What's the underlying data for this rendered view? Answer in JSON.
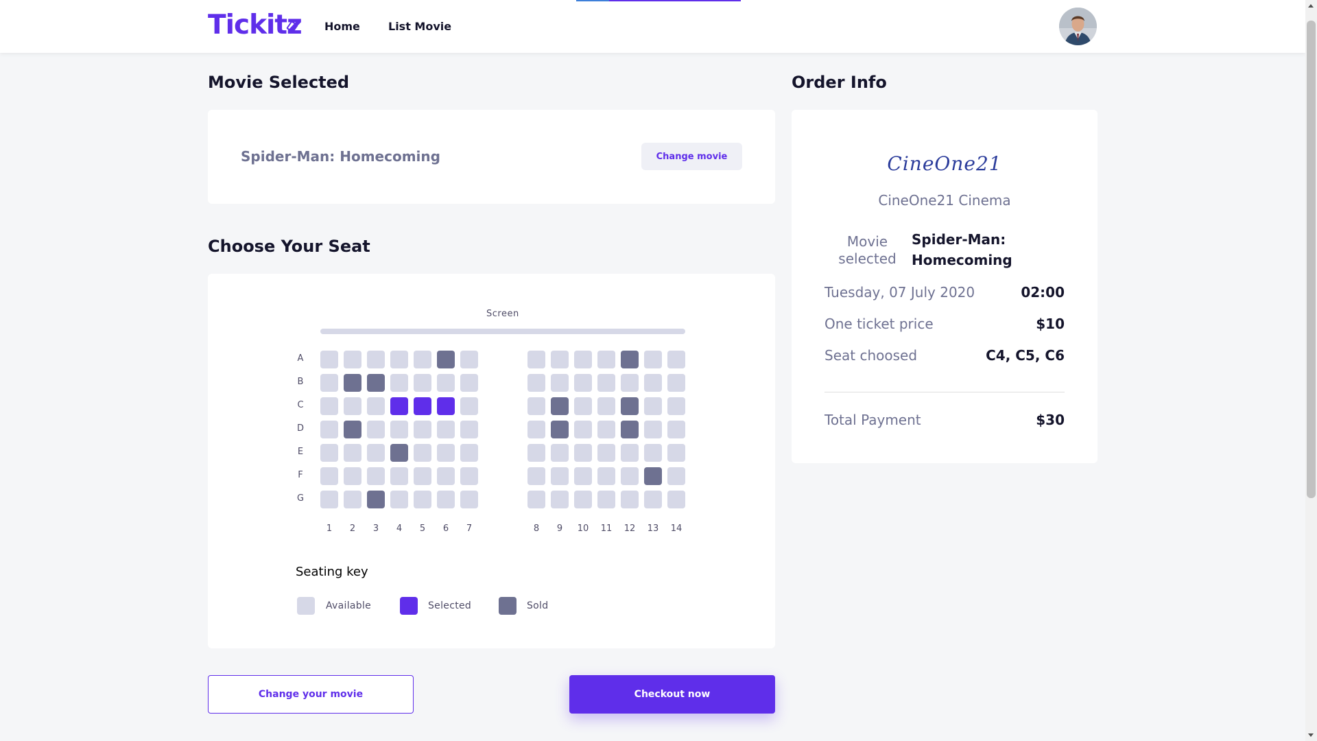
{
  "header": {
    "logo": "Tickitz",
    "nav": [
      "Home",
      "List Movie"
    ]
  },
  "movie_section": {
    "title": "Movie Selected",
    "movie_name": "Spider-Man: Homecoming",
    "change_button": "Change movie"
  },
  "seat_section": {
    "title": "Choose Your Seat",
    "screen_label": "Screen",
    "rows": [
      "A",
      "B",
      "C",
      "D",
      "E",
      "F",
      "G"
    ],
    "columns": [
      "1",
      "2",
      "3",
      "4",
      "5",
      "6",
      "7",
      "8",
      "9",
      "10",
      "11",
      "12",
      "13",
      "14"
    ],
    "sold": [
      "A6",
      "A12",
      "B2",
      "B3",
      "C9",
      "C12",
      "D2",
      "D9",
      "D12",
      "E4",
      "F13",
      "G3"
    ],
    "selected": [
      "C4",
      "C5",
      "C6"
    ],
    "key": {
      "title": "Seating key",
      "available": "Available",
      "selected": "Selected",
      "sold": "Sold"
    },
    "colors": {
      "available": "#d6d8e7",
      "selected": "#5f2eea",
      "sold": "#6e7191"
    }
  },
  "actions": {
    "change": "Change your movie",
    "checkout": "Checkout now"
  },
  "order_info": {
    "title": "Order Info",
    "cinema_logo": "CineOne21",
    "cinema_name": "CineOne21 Cinema",
    "movie_label_1": "Movie",
    "movie_label_2": "selected",
    "movie_value_1": "Spider-Man:",
    "movie_value_2": "Homecoming",
    "date": "Tuesday, 07 July 2020",
    "time": "02:00",
    "price_label": "One ticket price",
    "price_value": "$10",
    "seat_label": "Seat choosed",
    "seat_value": "C4, C5, C6",
    "total_label": "Total Payment",
    "total_value": "$30"
  }
}
